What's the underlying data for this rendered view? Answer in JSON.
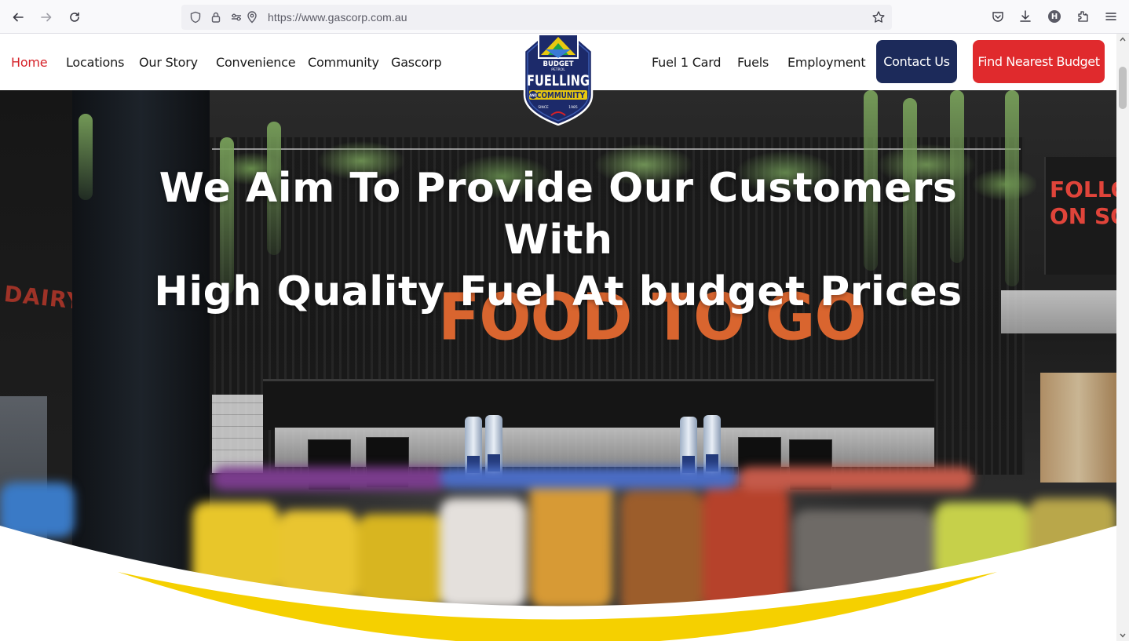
{
  "browser": {
    "url": "https://www.gascorp.com.au",
    "account_initial": "H",
    "icons": [
      "back-arrow-icon",
      "forward-arrow-icon",
      "reload-icon",
      "shield-icon",
      "lock-icon",
      "permissions-icon",
      "location-icon",
      "bookmark-star-icon",
      "pocket-icon",
      "download-icon",
      "account-icon",
      "extensions-icon",
      "menu-icon"
    ]
  },
  "header": {
    "nav_left": [
      {
        "label": "Home",
        "active": true
      },
      {
        "label": "Locations",
        "active": false
      },
      {
        "label": "Our Story",
        "active": false
      },
      {
        "label": "Convenience",
        "active": false
      },
      {
        "label": "Community",
        "active": false
      },
      {
        "label": "Gascorp",
        "active": false
      }
    ],
    "nav_right": [
      {
        "label": "Fuel 1 Card"
      },
      {
        "label": "Fuels"
      },
      {
        "label": "Employment"
      }
    ],
    "contact_label": "Contact Us",
    "nearest_label": "Find Nearest Budget",
    "logo": {
      "top_text": "BUDGET",
      "sub_text": "PETROL",
      "main_text": "FUELLING",
      "and_text": "AND",
      "community_text": "COMMUNITY",
      "since_text": "SINCE",
      "year_text": "1985"
    }
  },
  "hero": {
    "title_line1": "We Aim To Provide Our Customers With",
    "title_line2": "High Quality Fuel At budget Prices",
    "sign_text": "FOOD TO GO",
    "left_sign_text": "DAIRY",
    "right_sign_line1": "FOLLOW",
    "right_sign_line2": "ON SOC"
  },
  "colors": {
    "accent_red": "#d62128",
    "navy": "#1c2a5a",
    "button_red": "#e02a2d",
    "swoosh_yellow": "#f5d000"
  }
}
